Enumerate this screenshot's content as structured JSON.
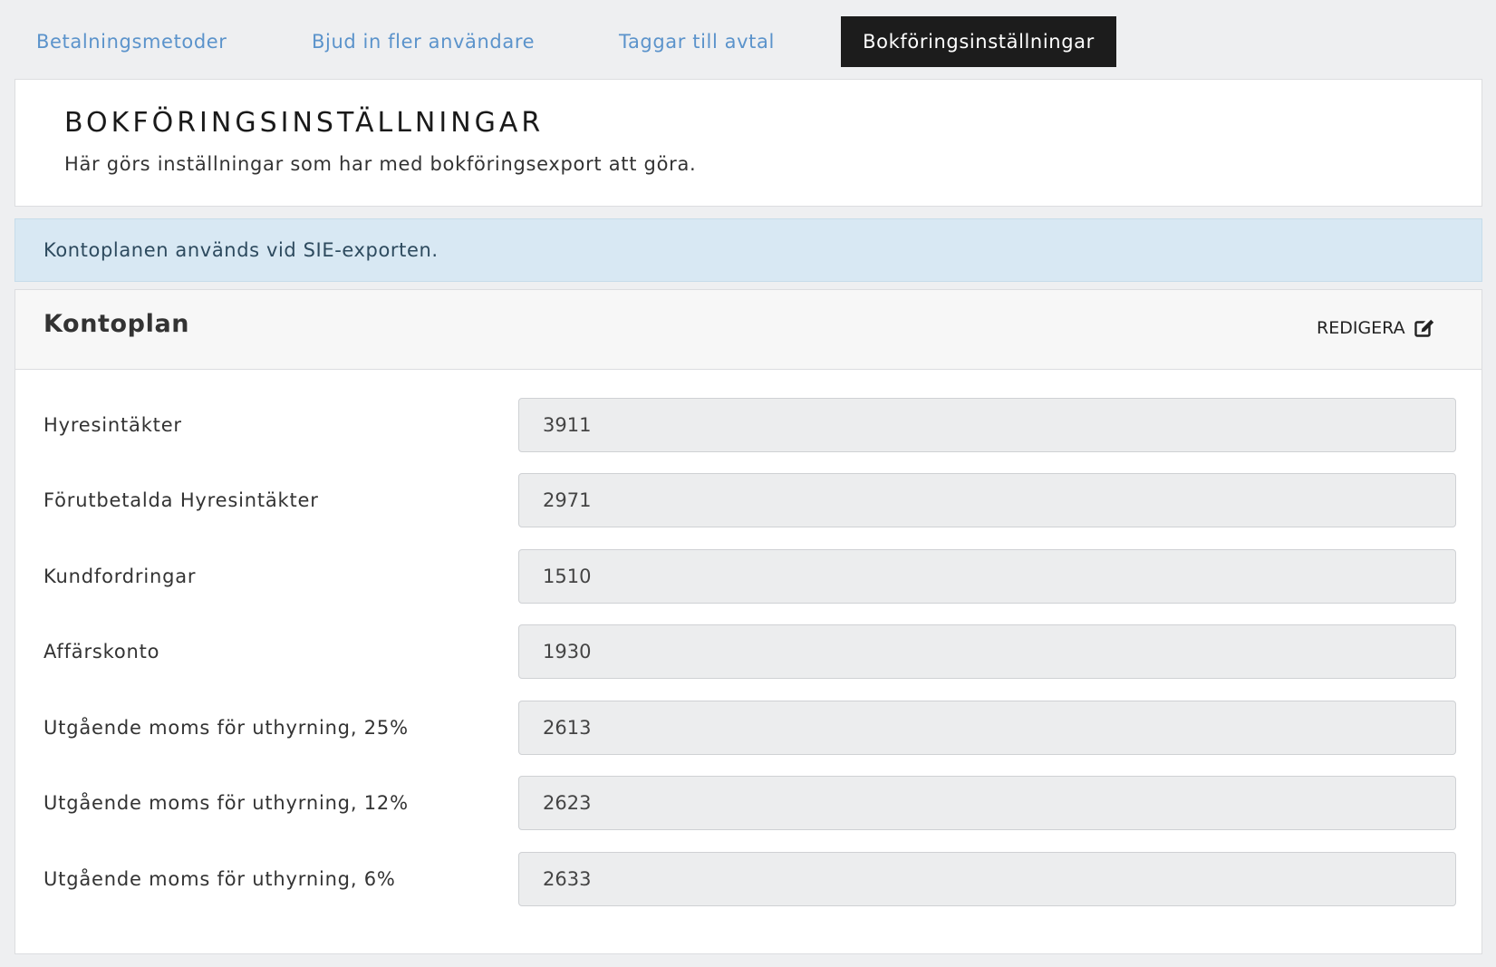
{
  "tabs": [
    {
      "label": "Betalningsmetoder",
      "active": false
    },
    {
      "label": "Bjud in fler användare",
      "active": false
    },
    {
      "label": "Taggar till avtal",
      "active": false
    },
    {
      "label": "Bokföringsinställningar",
      "active": true
    }
  ],
  "header": {
    "title": "BOKFÖRINGSINSTÄLLNINGAR",
    "subtitle": "Här görs inställningar som har med bokföringsexport att göra."
  },
  "alert": {
    "text": "Kontoplanen används vid SIE-exporten."
  },
  "panel": {
    "title": "Kontoplan",
    "edit_label": "REDIGERA",
    "edit_icon": "edit-icon",
    "fields": [
      {
        "label": "Hyresintäkter",
        "value": "3911"
      },
      {
        "label": "Förutbetalda Hyresintäkter",
        "value": "2971"
      },
      {
        "label": "Kundfordringar",
        "value": "1510"
      },
      {
        "label": "Affärskonto",
        "value": "1930"
      },
      {
        "label": "Utgående moms för uthyrning, 25%",
        "value": "2613"
      },
      {
        "label": "Utgående moms för uthyrning, 12%",
        "value": "2623"
      },
      {
        "label": "Utgående moms för uthyrning, 6%",
        "value": "2633"
      }
    ]
  },
  "colors": {
    "page_bg": "#eeeff1",
    "tab_link": "#5b93cb",
    "tab_active_bg": "#1c1c1c",
    "alert_bg": "#d8e8f3",
    "input_bg": "#ecedee"
  }
}
